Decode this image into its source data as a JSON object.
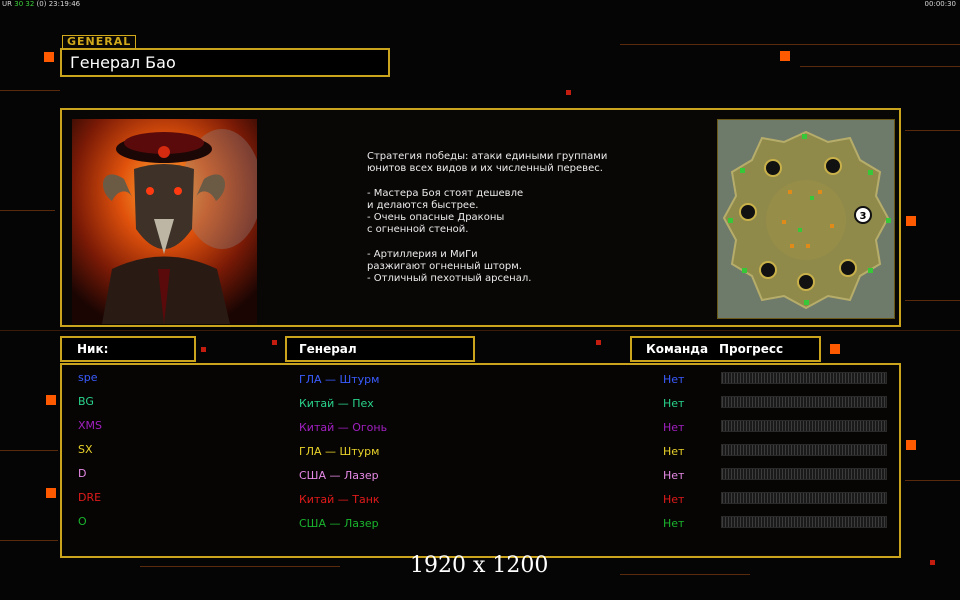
{
  "status": {
    "left_prefix": "UR",
    "left_fps": "30 32",
    "left_flag": "0",
    "left_time": "23:19:46",
    "right_time": "00:00:30"
  },
  "general_tag": "GENERAL",
  "general_name": "Генерал Бао",
  "description": [
    "Стратегия победы: атаки едиными группами",
    "юнитов всех видов и их численный перевес.",
    "",
    "- Мастера Боя стоят дешевле",
    "и делаются быстрее.",
    "- Очень опасные Драконы",
    "с огненной стеной.",
    "",
    "- Артиллерия и МиГи",
    "разжигают огненный шторм.",
    "- Отличный пехотный арсенал."
  ],
  "minimap": {
    "player_count_badge": "3"
  },
  "columns": {
    "nick": "Ник:",
    "general": "Генерал",
    "team": "Команда",
    "progress": "Прогресс"
  },
  "players": [
    {
      "nick": "spe",
      "general": "ГЛА — Штурм",
      "team": "Нет",
      "color": "#3a5cff"
    },
    {
      "nick": "BG",
      "general": "Китай — Пех",
      "team": "Нет",
      "color": "#29d38b"
    },
    {
      "nick": "XMS",
      "general": "Китай — Огонь",
      "team": "Нет",
      "color": "#a020c0"
    },
    {
      "nick": "SX",
      "general": "ГЛА — Штурм",
      "team": "Нет",
      "color": "#e8d22a"
    },
    {
      "nick": "D",
      "general": "США — Лазер",
      "team": "Нет",
      "color": "#e68ae6"
    },
    {
      "nick": "DRE",
      "general": "Китай — Танк",
      "team": "Нет",
      "color": "#e01a1a"
    },
    {
      "nick": "O",
      "general": "США — Лазер",
      "team": "Нет",
      "color": "#19b42d"
    }
  ],
  "resolution_label": "1920 x 1200"
}
